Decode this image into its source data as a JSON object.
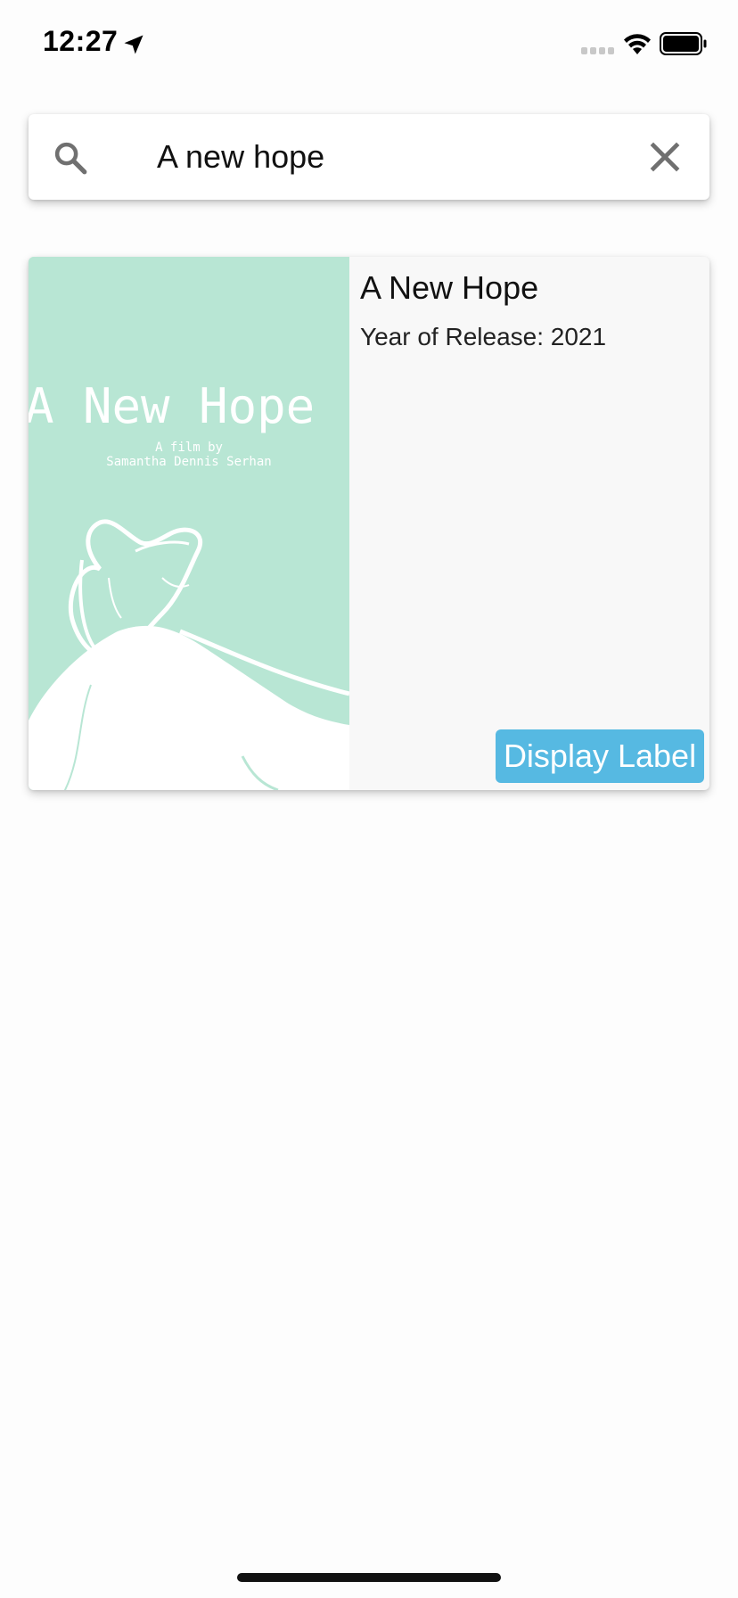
{
  "status_bar": {
    "time": "12:27",
    "icons": [
      "location-arrow-icon",
      "cellular-signal-icon",
      "wifi-icon",
      "battery-icon"
    ]
  },
  "search": {
    "value": "A new hope",
    "icons": [
      "search-icon",
      "clear-icon"
    ]
  },
  "results": [
    {
      "title": "A New Hope",
      "release_label": "Year of Release:",
      "release_year": "2021",
      "poster": {
        "title_text": "A New Hope",
        "credit_line_1": "A film by",
        "credit_line_2": "Samantha Dennis Serhan"
      },
      "button_label": "Display Label"
    }
  ],
  "colors": {
    "poster_bg": "#b8e6d4",
    "button_bg": "#56b9e2",
    "card_bg": "#f8f8f8"
  }
}
